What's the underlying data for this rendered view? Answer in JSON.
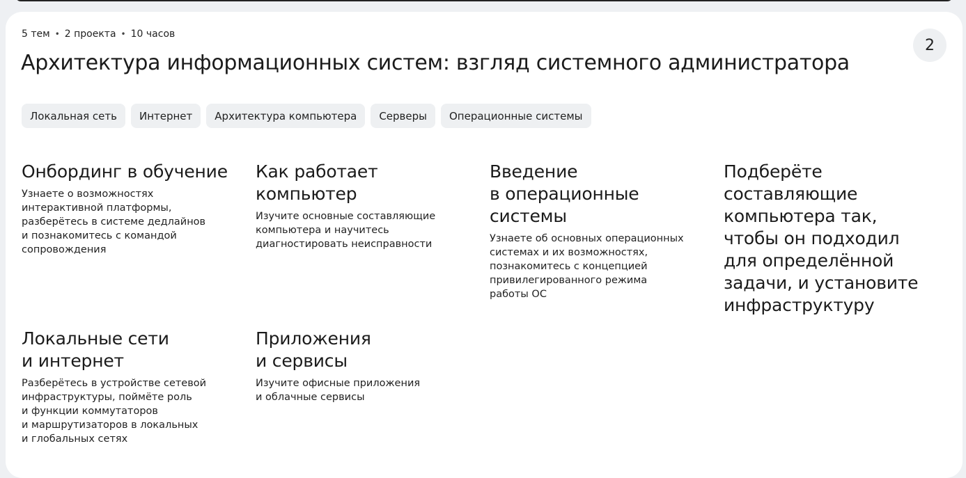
{
  "course": {
    "meta": {
      "topics": "5 тем",
      "projects": "2 проекта",
      "hours": "10 часов",
      "separator": "•"
    },
    "title": "Архитектура информационных систем: взгляд системного администратора",
    "number": "2",
    "tags": [
      "Локальная сеть",
      "Интернет",
      "Архитектура компьютера",
      "Серверы",
      "Операционные системы"
    ],
    "modules": [
      {
        "title_lines": [
          "Онбординг в обучение"
        ],
        "desc_lines": [
          "Узнаете о возможностях",
          "интерактивной платформы,",
          "разберётесь в системе дедлайнов",
          "и познакомитесь с командой",
          "сопровождения"
        ]
      },
      {
        "title_lines": [
          "Как работает",
          "компьютер"
        ],
        "desc_lines": [
          "Изучите основные составляющие",
          "компьютера и научитесь",
          "диагностировать неисправности"
        ]
      },
      {
        "title_lines": [
          "Введение",
          "в операционные",
          "системы"
        ],
        "desc_lines": [
          "Узнаете об основных операционных",
          "системах и их возможностях,",
          "познакомитесь с концепцией",
          "привилегированного режима",
          "работы ОС"
        ]
      },
      {
        "title_lines": [
          "Подберёте",
          "составляющие",
          "компьютера так,",
          "чтобы он подходил",
          "для определённой",
          "задачи, и установите",
          "инфраструктуру"
        ],
        "desc_lines": []
      },
      {
        "title_lines": [
          "Локальные сети",
          "и интернет"
        ],
        "desc_lines": [
          "Разберётесь в устройстве сетевой",
          "инфраструктуры, поймёте роль",
          "и функции коммутаторов",
          "и маршрутизаторов в локальных",
          "и глобальных сетях"
        ]
      },
      {
        "title_lines": [
          "Приложения",
          "и сервисы"
        ],
        "desc_lines": [
          "Изучите офисные приложения",
          "и облачные сервисы"
        ]
      }
    ]
  }
}
